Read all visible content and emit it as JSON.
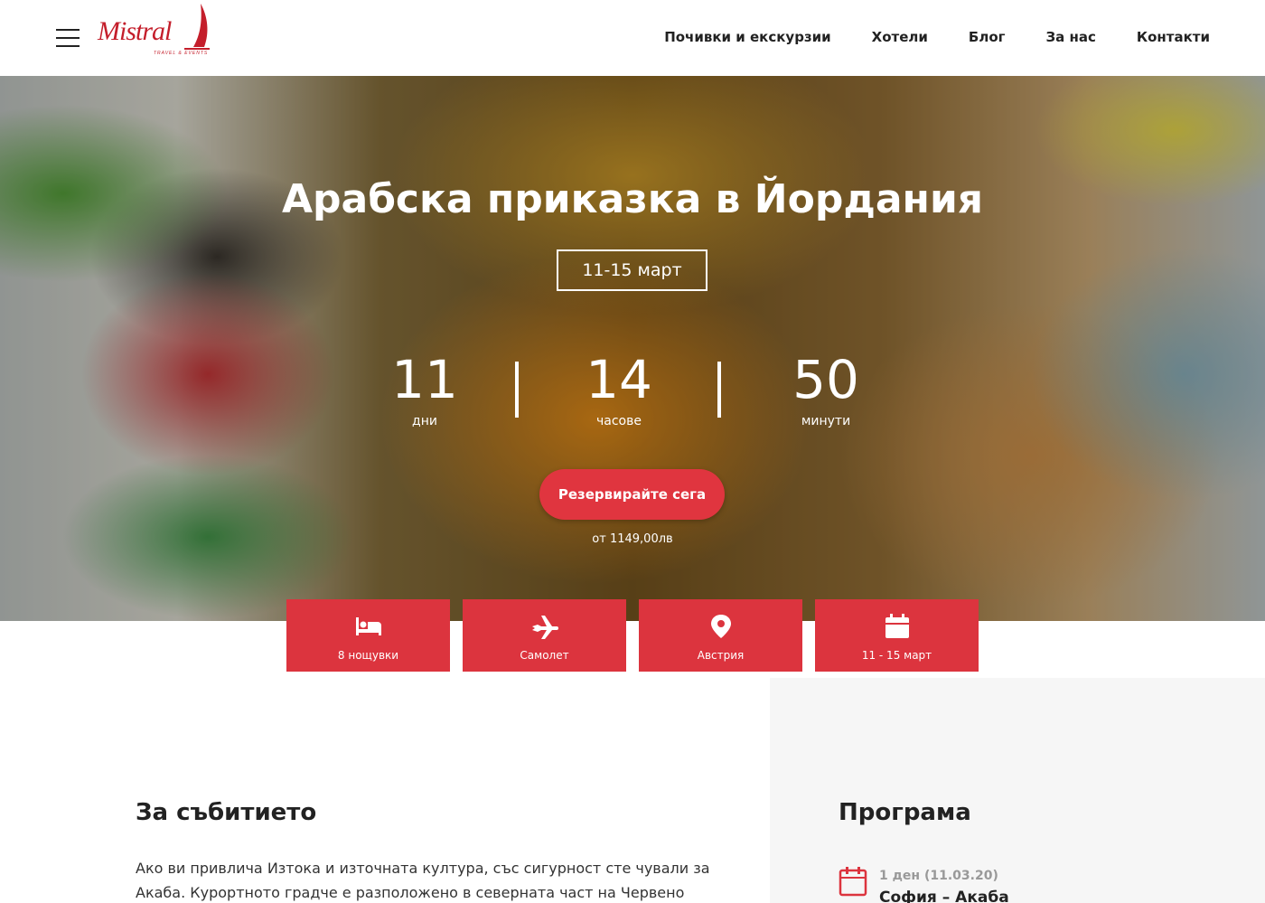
{
  "header": {
    "logo": {
      "name": "Mistral",
      "tagline": "TRAVEL & EVENTS"
    },
    "nav": [
      "Почивки и екскурзии",
      "Хотели",
      "Блог",
      "За нас",
      "Контакти"
    ]
  },
  "hero": {
    "title": "Арабска приказка в Йордания",
    "date_badge": "11-15 март",
    "countdown": [
      {
        "value": "11",
        "label": "дни"
      },
      {
        "value": "14",
        "label": "часове"
      },
      {
        "value": "50",
        "label": "минути"
      }
    ],
    "cta": "Резервирайте сега",
    "price": "от 1149,00лв"
  },
  "features": [
    {
      "icon": "bed-icon",
      "label": "8 нощувки"
    },
    {
      "icon": "plane-icon",
      "label": "Самолет"
    },
    {
      "icon": "location-pin-icon",
      "label": "Австрия"
    },
    {
      "icon": "calendar-icon",
      "label": "11 - 15 март"
    }
  ],
  "about": {
    "title": "За събитието",
    "text": "Ако ви привлича Изтока и източната култура, със сигурност сте чували за Акаба. Курортното градче е разположено в северната част на Червено"
  },
  "program": {
    "title": "Програма",
    "items": [
      {
        "day": "1 ден (11.03.20)",
        "route": "София – Акаба"
      }
    ]
  },
  "colors": {
    "accent": "#dc343e",
    "logo": "#c41e2b"
  }
}
